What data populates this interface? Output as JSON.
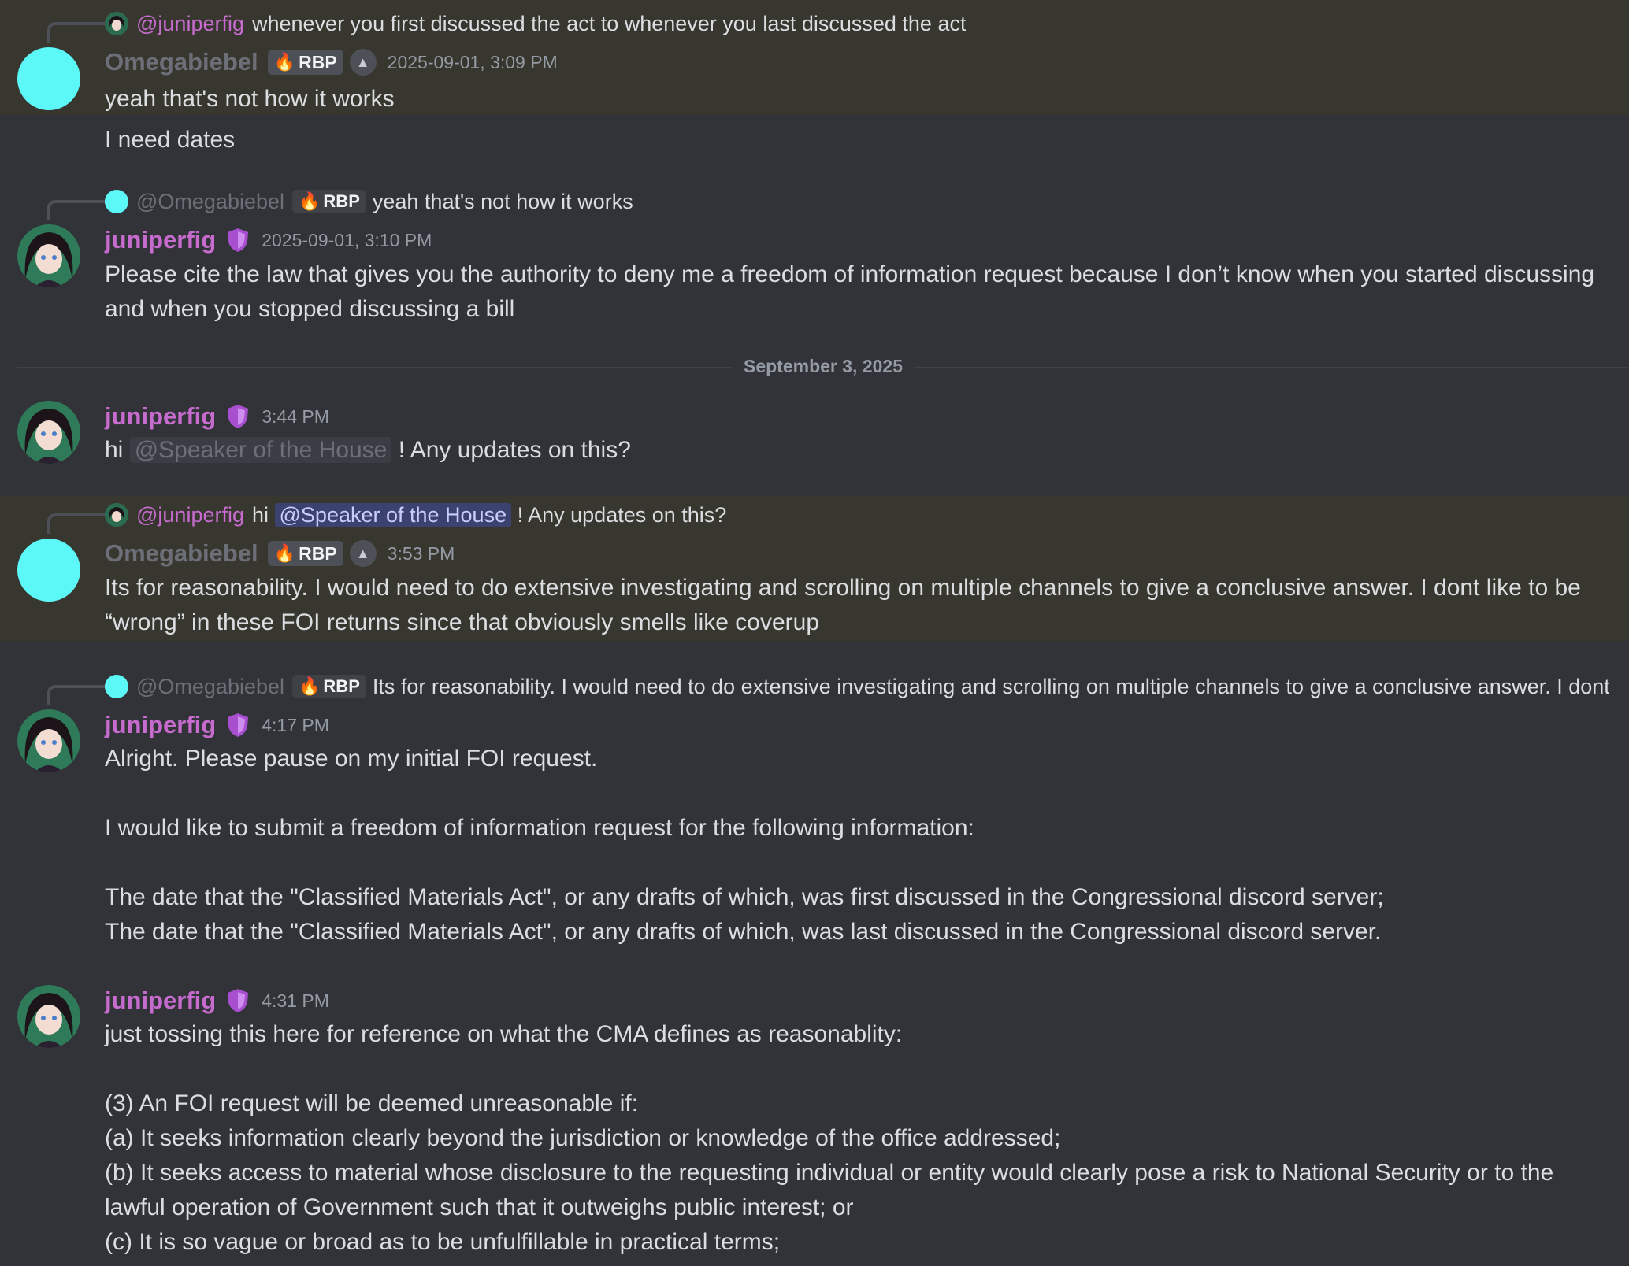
{
  "date_divider": "September 3, 2025",
  "messages": [
    {
      "reply_to": {
        "name": "@juniperfig",
        "text": "whenever you first discussed the act to whenever you last discussed the act"
      },
      "author": "Omegabiebel",
      "tag": "RBP",
      "timestamp": "2025-09-01, 3:09 PM",
      "lines": [
        "yeah that's not how it works",
        "I need dates"
      ]
    },
    {
      "reply_to": {
        "name": "@Omegabiebel",
        "tag": "RBP",
        "text": "yeah that's not how it works"
      },
      "author": "juniperfig",
      "timestamp": "2025-09-01, 3:10 PM",
      "lines": [
        "Please cite the law that gives you the authority to deny me a freedom of information request because I don’t know when you started discussing and when you stopped discussing a bill"
      ]
    },
    {
      "author": "juniperfig",
      "timestamp": "3:44 PM",
      "text_before": "hi",
      "mention": "@Speaker of the House",
      "text_after": "! Any updates on this?"
    },
    {
      "reply_to": {
        "name": "@juniperfig",
        "text_before": "hi",
        "mention": "@Speaker of the House",
        "text_after": "! Any updates on this?"
      },
      "author": "Omegabiebel",
      "tag": "RBP",
      "timestamp": "3:53 PM",
      "lines": [
        "Its for reasonability. I would need to do extensive investigating and scrolling on multiple channels to give a conclusive answer. I dont like to be “wrong” in these FOI returns since that obviously smells like coverup"
      ]
    },
    {
      "reply_to": {
        "name": "@Omegabiebel",
        "tag": "RBP",
        "text": "Its for reasonability. I would need to do extensive investigating and scrolling on multiple channels to give a conclusive answer. I dont li..."
      },
      "author": "juniperfig",
      "timestamp": "4:17 PM",
      "lines": [
        "Alright. Please pause on my initial FOI request.",
        "",
        "I would like to submit a freedom of information request for the following information:",
        "",
        "The date that the \"Classified Materials Act\", or any drafts of which, was first discussed in the Congressional discord server;",
        "The date that the \"Classified Materials Act\", or any drafts of which, was last discussed in the Congressional discord server."
      ]
    },
    {
      "author": "juniperfig",
      "timestamp": "4:31 PM",
      "lines": [
        "just tossing this here for reference on what the CMA defines as reasonablity:",
        "",
        "(3) An FOI request will be deemed unreasonable if:",
        "(a) It seeks information clearly beyond the jurisdiction or knowledge of the office addressed;",
        "(b) It seeks access to material whose disclosure to the requesting individual or entity would clearly pose a risk to National Security or to the lawful operation of Government such that it outweighs public interest; or",
        "(c) It is so vague or broad as to be unfulfillable in practical terms;"
      ]
    }
  ],
  "icons": {
    "role_badge": "shield-icon",
    "rbp_badge": "fire-icon",
    "capitol_badge": "capitol-icon"
  },
  "colors": {
    "background": "#313338",
    "highlight": "#38372f",
    "name_pink": "#c76bcf",
    "name_grey": "#6d6f78",
    "avatar_cyan": "#5cf7f7"
  }
}
